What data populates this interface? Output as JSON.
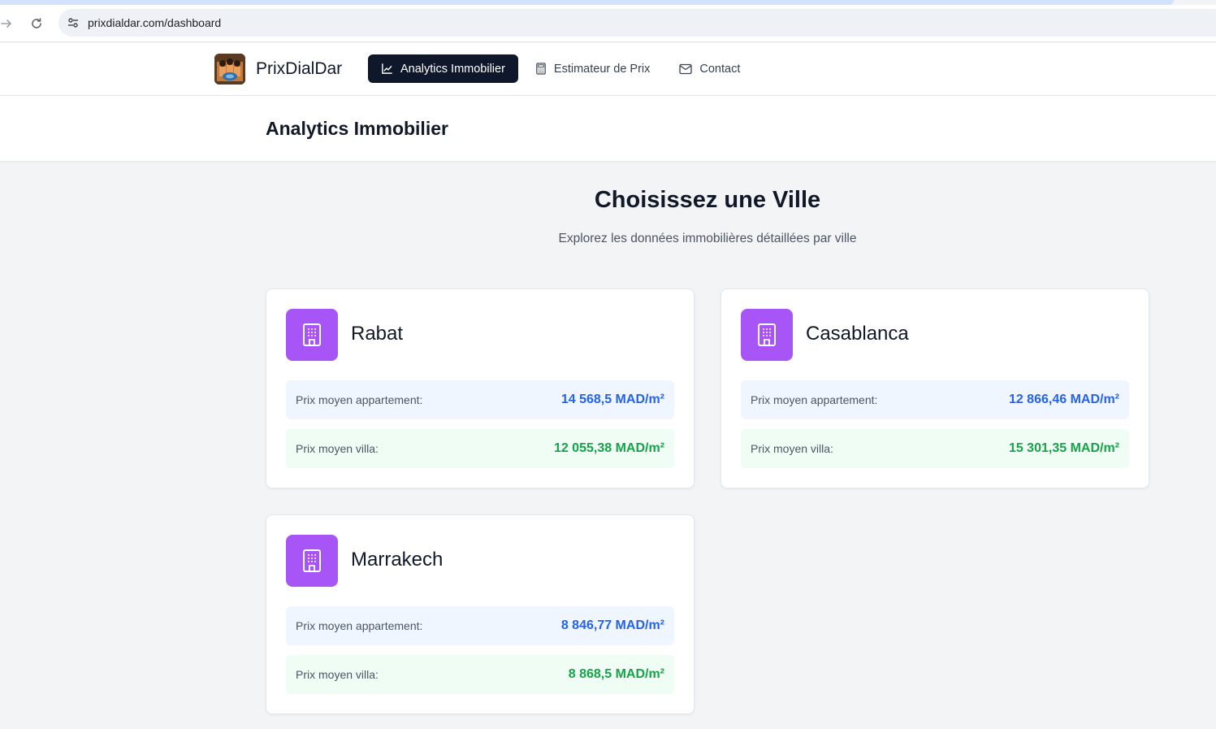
{
  "browser": {
    "url": "prixdialdar.com/dashboard",
    "forward_icon": "arrow-right-icon",
    "reload_icon": "reload-icon",
    "site_info_icon": "tune-icon"
  },
  "header": {
    "brand_name": "PrixDialDar",
    "nav": [
      {
        "label": "Analytics Immobilier",
        "icon": "chart-line-icon",
        "active": true
      },
      {
        "label": "Estimateur de Prix",
        "icon": "calculator-icon",
        "active": false
      },
      {
        "label": "Contact",
        "icon": "mail-icon",
        "active": false
      }
    ]
  },
  "page": {
    "title": "Analytics Immobilier"
  },
  "section": {
    "title": "Choisissez une Ville",
    "subtitle": "Explorez les données immobilières détaillées par ville"
  },
  "cities": [
    {
      "name": "Rabat",
      "icon": "building-icon",
      "apt_label": "Prix moyen appartement:",
      "apt_value": "14 568,5 MAD/m²",
      "villa_label": "Prix moyen villa:",
      "villa_value": "12 055,38 MAD/m²"
    },
    {
      "name": "Casablanca",
      "icon": "building-icon",
      "apt_label": "Prix moyen appartement:",
      "apt_value": "12 866,46 MAD/m²",
      "villa_label": "Prix moyen villa:",
      "villa_value": "15 301,35 MAD/m²"
    },
    {
      "name": "Marrakech",
      "icon": "building-icon",
      "apt_label": "Prix moyen appartement:",
      "apt_value": "8 846,77 MAD/m²",
      "villa_label": "Prix moyen villa:",
      "villa_value": "8 868,5 MAD/m²"
    }
  ],
  "colors": {
    "accent_dark": "#0f172a",
    "city_icon_bg": "#a855f7",
    "apartment_value": "#2563eb",
    "villa_value": "#16a34a"
  }
}
